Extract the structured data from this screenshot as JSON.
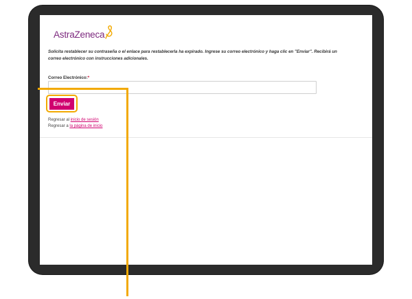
{
  "brand": {
    "name": "AstraZeneca",
    "colors": {
      "accent": "#d0006f",
      "brand": "#7d2a7f",
      "callout": "#f2a900"
    }
  },
  "message": "Solicita restablecer su contraseña o el enlace para restablecerla ha expirado. Ingrese su correo electrónico y haga clic en \"Enviar\". Recibirá un correo electrónico con instrucciones adicionales.",
  "form": {
    "email_label": "Correo Electrónico:",
    "required_mark": "*",
    "email_value": "",
    "email_placeholder": "",
    "submit_label": "Enviar"
  },
  "links": {
    "login": {
      "prefix": "Regresar al ",
      "text": "inicio de sesión"
    },
    "home": {
      "prefix": "Regresar a ",
      "text": "la página de inicio"
    }
  }
}
